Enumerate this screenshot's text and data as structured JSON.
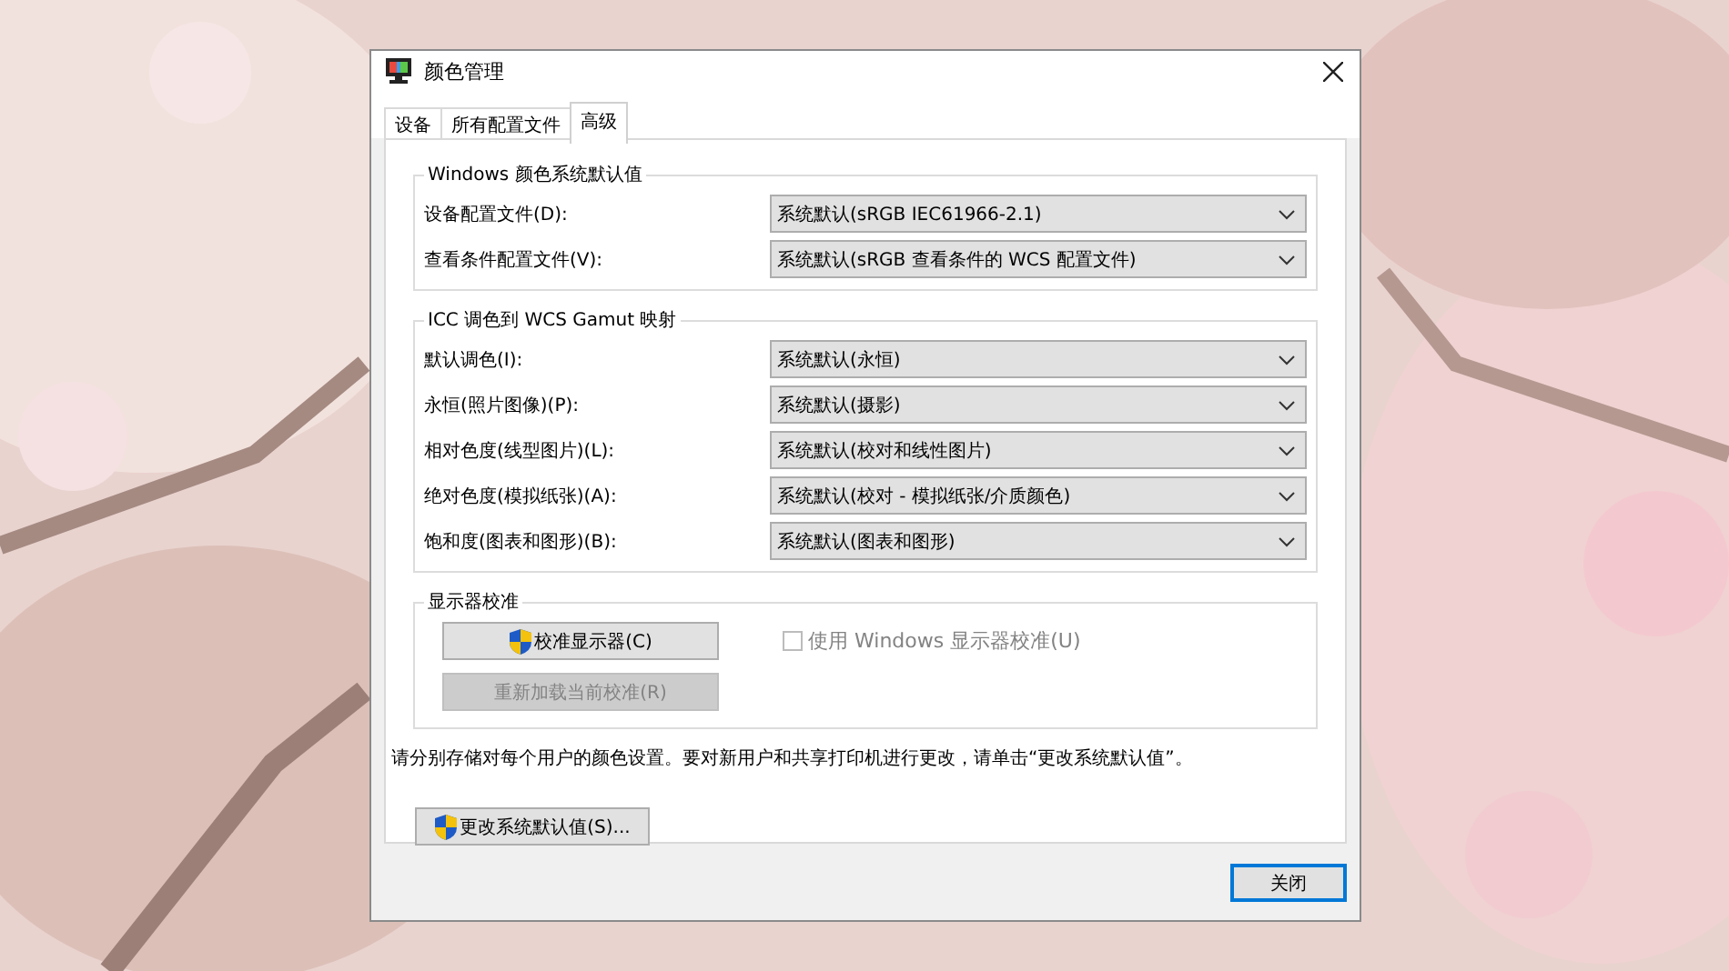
{
  "window": {
    "title": "颜色管理"
  },
  "tabs": [
    {
      "label": "设备",
      "selected": false
    },
    {
      "label": "所有配置文件",
      "selected": false
    },
    {
      "label": "高级",
      "selected": true
    }
  ],
  "groups": [
    {
      "kind": "dropdowns",
      "title": "Windows 颜色系统默认值",
      "rows": [
        {
          "label": "设备配置文件(D):",
          "value": "系统默认(sRGB IEC61966-2.1)"
        },
        {
          "label": "查看条件配置文件(V):",
          "value": "系统默认(sRGB 查看条件的 WCS 配置文件)"
        }
      ]
    },
    {
      "kind": "dropdowns",
      "title": "ICC 调色到 WCS Gamut 映射",
      "rows": [
        {
          "label": "默认调色(I):",
          "value": "系统默认(永恒)"
        },
        {
          "label": "永恒(照片图像)(P):",
          "value": "系统默认(摄影)"
        },
        {
          "label": "相对色度(线型图片)(L):",
          "value": "系统默认(校对和线性图片)"
        },
        {
          "label": "绝对色度(模拟纸张)(A):",
          "value": "系统默认(校对 - 模拟纸张/介质颜色)"
        },
        {
          "label": "饱和度(图表和图形)(B):",
          "value": "系统默认(图表和图形)"
        }
      ]
    },
    {
      "kind": "calibration",
      "title": "显示器校准",
      "buttons": [
        {
          "label": "校准显示器(C)",
          "shield": true,
          "disabled": false
        },
        {
          "label": "重新加载当前校准(R)",
          "shield": false,
          "disabled": true
        }
      ],
      "checkbox": {
        "label": "使用 Windows 显示器校准(U)",
        "checked": false,
        "disabled": true
      }
    }
  ],
  "note": "请分别存储对每个用户的颜色设置。要对新用户和共享打印机进行更改，请单击“更改系统默认值”。",
  "change_defaults_button": {
    "label": "更改系统默认值(S)...",
    "shield": true
  },
  "close_button": {
    "label": "关闭",
    "default": true
  }
}
